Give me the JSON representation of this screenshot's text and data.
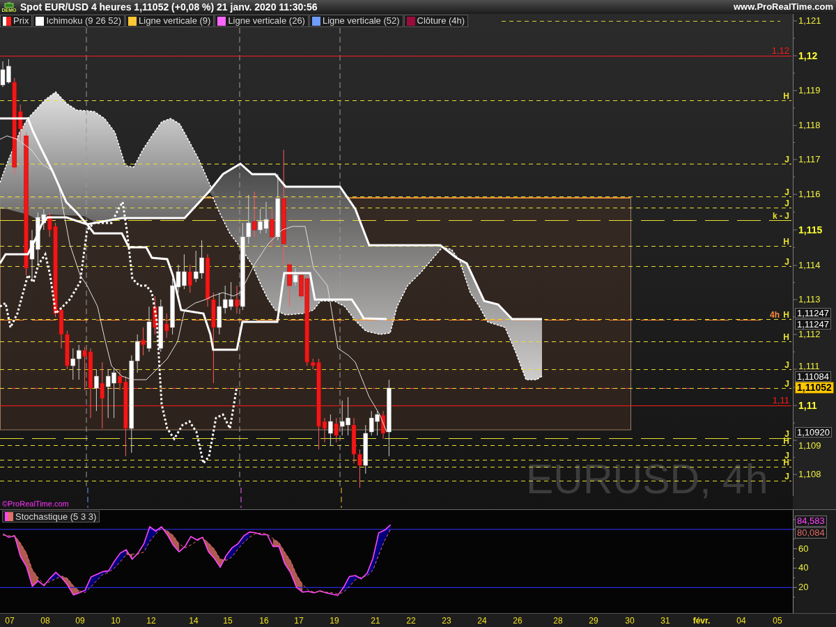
{
  "title_bar": {
    "badge": "DEMO",
    "title": "Spot EUR/USD 4 heures 1,11052 (+0,08 %) 21 janv. 2020 11:30:56",
    "website": "www.ProRealTime.com"
  },
  "legend": [
    {
      "label": "Prix",
      "kind": "candle",
      "color": "#ff1f1f"
    },
    {
      "label": "Ichimoku (9 26 52)",
      "kind": "line",
      "color": "#ffffff"
    },
    {
      "label": "Ligne verticale (9)",
      "kind": "line",
      "color": "#ffc733"
    },
    {
      "label": "Ligne verticale (26)",
      "kind": "line",
      "color": "#ff66ff"
    },
    {
      "label": "Ligne verticale (52)",
      "kind": "line",
      "color": "#6f9cff"
    },
    {
      "label": "Clôture (4h)",
      "kind": "line",
      "color": "#9b0c3c"
    }
  ],
  "price_chart": {
    "levels": [
      {
        "label": "1,12",
        "kind": "solid",
        "color": "#ff1a1a"
      },
      {
        "label": "H",
        "kind": "dashed",
        "color": "#e8e030"
      },
      {
        "label": "J",
        "kind": "dashed",
        "color": "#e8e030"
      },
      {
        "label": "J",
        "kind": "dashed",
        "color": "#e8e030"
      },
      {
        "label": "J",
        "kind": "dashed",
        "color": "#e8e030"
      },
      {
        "label": "k - J",
        "kind": "long_dash",
        "color": "#e8e030"
      },
      {
        "label": "H",
        "kind": "dashed",
        "color": "#e8e030"
      },
      {
        "label": "J",
        "kind": "dashed",
        "color": "#e8e030"
      },
      {
        "label": "4h",
        "kind": "long_dash",
        "color": "#ff8a3a"
      },
      {
        "label": "H",
        "kind": "dashed",
        "color": "#e8e030"
      },
      {
        "label": "H",
        "kind": "dashed",
        "color": "#e8e030"
      },
      {
        "label": "J",
        "kind": "dashed",
        "color": "#e8e030"
      },
      {
        "label": "J",
        "kind": "dashed",
        "color": "#e8e030"
      },
      {
        "label": "1,11",
        "kind": "solid",
        "color": "#ff1a1a"
      },
      {
        "label": "J",
        "kind": "long_dash",
        "color": "#e8e030"
      },
      {
        "label": "H",
        "kind": "dashed",
        "color": "#e8e030"
      },
      {
        "label": "J",
        "kind": "dashed",
        "color": "#e8e030"
      },
      {
        "label": "H",
        "kind": "dashed",
        "color": "#e8e030"
      },
      {
        "label": "J",
        "kind": "dashed",
        "color": "#e8e030"
      }
    ],
    "price_axis": [
      {
        "text": "1,121",
        "bold": false
      },
      {
        "text": "1,12",
        "bold": true
      },
      {
        "text": "1,119",
        "bold": false
      },
      {
        "text": "1,118",
        "bold": false
      },
      {
        "text": "1,117",
        "bold": false
      },
      {
        "text": "1,116",
        "bold": false
      },
      {
        "text": "1,115",
        "bold": true
      },
      {
        "text": "1,114",
        "bold": false
      },
      {
        "text": "1,113",
        "bold": false
      },
      {
        "text": "1,112",
        "bold": false
      },
      {
        "text": "1,111",
        "bold": false
      },
      {
        "text": "1,11",
        "bold": true
      },
      {
        "text": "1,109",
        "bold": false
      },
      {
        "text": "1,108",
        "bold": false
      }
    ],
    "price_tags": [
      {
        "text": "1,11247",
        "highlighted": false
      },
      {
        "text": "1,11247",
        "highlighted": false
      },
      {
        "text": "1,11084",
        "highlighted": false
      },
      {
        "text": "1,11052",
        "highlighted": true
      },
      {
        "text": "1,10920",
        "highlighted": false
      }
    ],
    "symbol_label": "EURUSD, 4h",
    "copyright": "©ProRealTime.com"
  },
  "stochastic_panel": {
    "chart_data": {
      "type": "line",
      "title": "Stochastique (5 3 3)",
      "categories": [
        null,
        null,
        null,
        null,
        null,
        null,
        null,
        null,
        null,
        null,
        null,
        null,
        null,
        null,
        null,
        null,
        null,
        null,
        null,
        null,
        null,
        null,
        null,
        null,
        null,
        null,
        null,
        null,
        null,
        null,
        null,
        null,
        null,
        null,
        null,
        null,
        null,
        null,
        null,
        null,
        null,
        null,
        null,
        null,
        null,
        null,
        null,
        null,
        null,
        null,
        null,
        null,
        null,
        null,
        null,
        null,
        null,
        null,
        null,
        null,
        null,
        null,
        null,
        null,
        null,
        null,
        null,
        null,
        null,
        null,
        null,
        null,
        null,
        null,
        null,
        null,
        null,
        null,
        null,
        null,
        null,
        null,
        null,
        null,
        null,
        null,
        null,
        null,
        null,
        null,
        null,
        null,
        null,
        null,
        null,
        null,
        null,
        null,
        null,
        null,
        null,
        null,
        null,
        null,
        null,
        null,
        null,
        null,
        null,
        null,
        null,
        null,
        null,
        null,
        null,
        null,
        null,
        null,
        null,
        null,
        null,
        null,
        null,
        null,
        null,
        null,
        null,
        null,
        null,
        null,
        null,
        null,
        null,
        null,
        null
      ],
      "ylim": [
        -6.4,
        100
      ],
      "yticks": [
        20,
        40,
        60
      ],
      "ref_lines": [
        {
          "axis": "y",
          "value": 80
        },
        {
          "axis": "y",
          "value": 20
        }
      ],
      "series": [
        {
          "color": "#ff44ff",
          "line_style": "solid",
          "values": [
            75.3,
            71.8,
            73.2,
            51.9,
            41.8,
            21.3,
            26.8,
            21.9,
            29.5,
            35.5,
            30.1,
            22.7,
            12.3,
            14.5,
            17.2,
            30.9,
            33.6,
            36.3,
            37.2,
            47.2,
            55.5,
            59.0,
            49.1,
            55.5,
            65.0,
            82.7,
            78.1,
            82.7,
            74.5,
            63.6,
            56.8,
            62.3,
            72.6,
            69.1,
            71.8,
            56.8,
            50.0,
            41.0,
            52.7,
            60.9,
            65.0,
            73.2,
            77.2,
            76.5,
            74.5,
            74.5,
            62.3,
            62.3,
            44.5,
            35.0,
            20.0,
            15.3,
            15.9,
            14.5,
            16.5,
            14.5,
            13.2,
            11.8,
            20.0,
            31.4,
            32.3,
            29.0,
            34.5,
            50.0,
            76.5,
            79.1,
            84.6,
            null,
            null,
            null,
            null,
            null,
            null,
            null,
            null,
            null,
            null,
            null,
            null,
            null,
            null,
            null,
            null,
            null,
            null,
            null,
            null,
            null,
            null,
            null,
            null,
            null,
            null,
            null,
            null,
            null,
            null,
            null,
            null,
            null,
            null,
            null,
            null,
            null,
            null,
            null,
            null,
            null,
            null,
            null,
            null,
            null,
            null,
            null,
            null,
            null,
            null,
            null,
            null,
            null,
            null,
            null,
            null,
            null,
            null,
            null,
            null,
            null,
            null,
            null,
            null,
            null,
            null,
            null,
            null
          ]
        },
        {
          "color": "#e0706a",
          "line_style": "dashed",
          "values": [
            74.0,
            73.4,
            73.4,
            65.6,
            55.6,
            38.3,
            30.0,
            23.3,
            26.1,
            29.0,
            31.7,
            29.4,
            21.7,
            16.5,
            14.7,
            20.9,
            27.2,
            33.6,
            35.7,
            40.2,
            46.6,
            53.9,
            54.5,
            54.5,
            56.5,
            67.7,
            75.3,
            81.2,
            78.4,
            73.6,
            65.0,
            60.9,
            63.9,
            68.0,
            71.2,
            65.9,
            59.5,
            49.3,
            47.9,
            51.5,
            59.5,
            66.4,
            71.8,
            75.6,
            76.1,
            75.2,
            70.4,
            66.4,
            56.4,
            47.3,
            33.2,
            23.4,
            17.1,
            15.2,
            15.6,
            15.2,
            14.7,
            13.2,
            15.0,
            21.1,
            27.9,
            30.9,
            31.9,
            37.8,
            53.7,
            68.5,
            80.1,
            null,
            null,
            null,
            null,
            null,
            null,
            null,
            null,
            null,
            null,
            null,
            null,
            null,
            null,
            null,
            null,
            null,
            null,
            null,
            null,
            null,
            null,
            null,
            null,
            null,
            null,
            null,
            null,
            null,
            null,
            null,
            null,
            null,
            null,
            null,
            null,
            null,
            null,
            null,
            null,
            null,
            null,
            null,
            null,
            null,
            null,
            null,
            null,
            null,
            null,
            null,
            null,
            null,
            null,
            null,
            null,
            null,
            null,
            null,
            null,
            null,
            null,
            null,
            null,
            null,
            null,
            null,
            null
          ]
        }
      ]
    },
    "readings": [
      {
        "text": "84,583",
        "color": "#ff44ff"
      },
      {
        "text": "80,084",
        "color": "#e06a6a"
      }
    ]
  },
  "x_axis": [
    {
      "label": "07",
      "bold": false
    },
    {
      "label": "08",
      "bold": false
    },
    {
      "label": "09",
      "bold": false
    },
    {
      "label": "10",
      "bold": false
    },
    {
      "label": "12",
      "bold": false
    },
    {
      "label": "14",
      "bold": false
    },
    {
      "label": "15",
      "bold": false
    },
    {
      "label": "16",
      "bold": false
    },
    {
      "label": "17",
      "bold": false
    },
    {
      "label": "19",
      "bold": false
    },
    {
      "label": "21",
      "bold": false
    },
    {
      "label": "22",
      "bold": false
    },
    {
      "label": "23",
      "bold": false
    },
    {
      "label": "24",
      "bold": false
    },
    {
      "label": "26",
      "bold": false
    },
    {
      "label": "28",
      "bold": false
    },
    {
      "label": "29",
      "bold": false
    },
    {
      "label": "30",
      "bold": false
    },
    {
      "label": "31",
      "bold": false
    },
    {
      "label": "févr.",
      "bold": true
    },
    {
      "label": "04",
      "bold": false
    },
    {
      "label": "05",
      "bold": false
    }
  ]
}
